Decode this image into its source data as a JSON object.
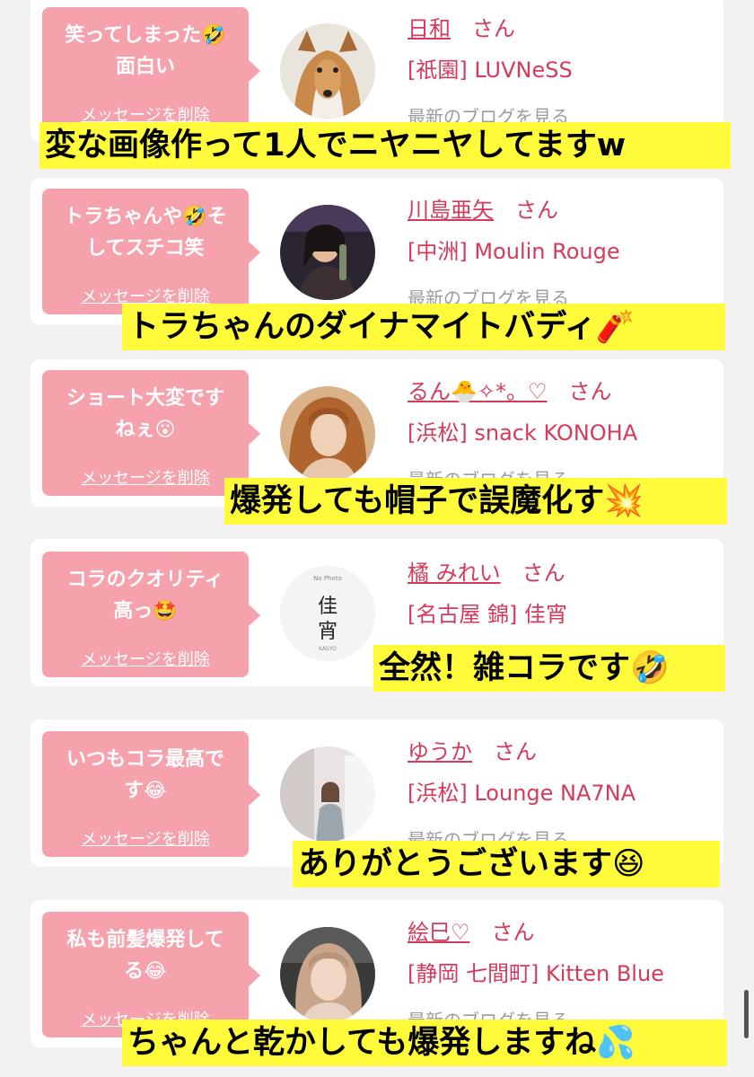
{
  "items": [
    {
      "comment": "笑ってしまった🤣\n面白い",
      "delete_label": "メッセージを削除",
      "name": "日和",
      "honorific": "さん",
      "shop": "[祇園] LUVNeSS",
      "blog_link": "最新のブログを見る",
      "caption": "変な画像作って1人でニヤニヤしてますw",
      "avatar": "dog-photo"
    },
    {
      "comment": "トラちゃんや🤣そ\nしてスチコ笑",
      "delete_label": "メッセージを削除",
      "name": "川島亜矢",
      "honorific": "さん",
      "shop": "[中洲] Moulin Rouge",
      "blog_link": "最新のブログを見る",
      "caption": "トラちゃんのダイナマイトバディ🧨",
      "avatar": "woman-photo"
    },
    {
      "comment": "ショート大変です\nねぇ😮",
      "delete_label": "メッセージを削除",
      "name": "るん🐣✧*。♡",
      "honorific": "さん",
      "shop": "[浜松] snack KONOHA",
      "blog_link": "最新のブログを見る",
      "caption": "爆発しても帽子で誤魔化す💥",
      "avatar": "woman-photo"
    },
    {
      "comment": "コラのクオリティ\n高っ🤩",
      "delete_label": "メッセージを削除",
      "name": "橘 みれい",
      "honorific": "さん",
      "shop": "[名古屋 錦] 佳宵",
      "blog_link": "最新のブログを見る",
      "caption": "全然！雑コラです🤣",
      "avatar": "no-photo-logo",
      "avatar_text": {
        "small": "No Photo",
        "logo": "佳宵",
        "roman": "KASYO"
      }
    },
    {
      "comment": "いつもコラ最高で\nす😂",
      "delete_label": "メッセージを削除",
      "name": "ゆうか",
      "honorific": "さん",
      "shop": "[浜松] Lounge NA7NA",
      "blog_link": "最新のブログを見る",
      "caption": "ありがとうございます😆",
      "avatar": "woman-photo"
    },
    {
      "comment": "私も前髪爆発して\nる😂",
      "delete_label": "メッセージを削除",
      "name": "絵巳♡",
      "honorific": "さん",
      "shop": "[静岡 七間町] Kitten Blue",
      "blog_link": "最新のブログを見る",
      "caption": "ちゃんと乾かしても爆発しますね💦",
      "avatar": "woman-photo"
    }
  ],
  "colors": {
    "bubble": "#f5a2ad",
    "accent": "#d63a5a",
    "caption_bg": "#fffb3a",
    "page_bg": "#f2f2f2"
  }
}
